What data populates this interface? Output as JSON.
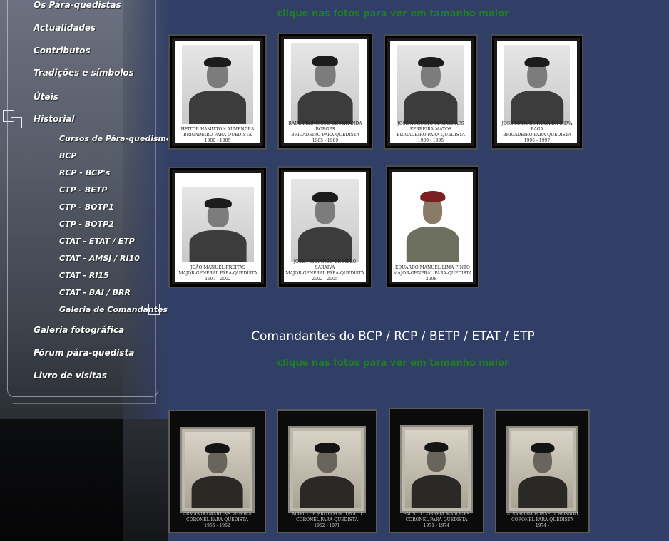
{
  "nav": {
    "items": [
      {
        "label": "Os Pára-quedistas"
      },
      {
        "label": "Actualidades"
      },
      {
        "label": "Contributos"
      },
      {
        "label": "Tradições e símbolos"
      },
      {
        "label": "Úteis"
      },
      {
        "label": "Historial"
      },
      {
        "label": "Galeria fotográfica"
      },
      {
        "label": "Fórum pára-quedista"
      },
      {
        "label": "Livro de visitas"
      }
    ],
    "historial_sub": [
      {
        "label": "Cursos de Pára-quedismo"
      },
      {
        "label": "BCP"
      },
      {
        "label": "RCP - BCP's"
      },
      {
        "label": "CTP - BETP"
      },
      {
        "label": "CTP - BOTP1"
      },
      {
        "label": "CTP - BOTP2"
      },
      {
        "label": "CTAT - ETAT / ETP"
      },
      {
        "label": "CTAT - AMSJ / RI10"
      },
      {
        "label": "CTAT - RI15"
      },
      {
        "label": "CTAT - BAI / BRR"
      },
      {
        "label": "Galeria de Comandantes"
      }
    ]
  },
  "content": {
    "click_hint_top": "clique nas fotos para ver em tamanho maior",
    "section_heading": "Comandantes do BCP / RCP / BETP / ETAT / ETP",
    "click_hint_bottom": "clique nas fotos para ver em tamanho maior",
    "top_gallery": [
      {
        "caption": "HEITOR HAMILTON ALMENDRA\nBRIGADEIRO PARA-QUEDISTA\n1980 - 1985"
      },
      {
        "caption": "RAUL FRANCISCO DE MIRANDA BORGES\nBRIGADEIRO PARA-QUEDISTA\n1985 - 1989"
      },
      {
        "caption": "JOSÉ AUGUSTO MAGALHÃES FERREIRA MATOS\nBRIGADEIRO PARA-QUEDISTA\n1989 - 1995"
      },
      {
        "caption": "JOSÉ MANUEL FARIA DA SILVA BAGA\nBRIGADEIRO PARA-QUEDISTA\n1995 - 1997"
      },
      {
        "caption": "JOÃO MANUEL FREITAS\nMAJOR-GENERAL PÁRA-QUEDISTA\n1997 - 2002"
      },
      {
        "caption": "JOSÉ FERNANDO DE MELO SARAIVA\nMAJOR-GENERAL PÁRA-QUEDISTA\n2002 - 2005"
      },
      {
        "caption": "EDUARDO MANUEL LIMA PINTO\nMAJOR-GENERAL PÁRA-QUEDISTA\n2008 -"
      }
    ],
    "bottom_gallery": [
      {
        "caption": "ARMANDO MARTINS VIDEIRA\nCORONEL PÁRA-QUEDISTA\n1955 - 1962"
      },
      {
        "caption": "MÁRIO DE BRITO FORTUNATO\nCORONEL PÁRA-QUEDISTA\n1962 - 1971"
      },
      {
        "caption": "FAUSTO CORREIA MARQUES\nCORONEL PÁRA-QUEDISTA\n1971 - 1974"
      },
      {
        "caption": "ALVARO DA FONSECA ROSADO\nCORONEL PÁRA-QUEDISTA\n1974 -"
      }
    ]
  },
  "colors": {
    "background": "#313e66",
    "hint_green": "#1f7d24",
    "heading": "#ffffff"
  }
}
